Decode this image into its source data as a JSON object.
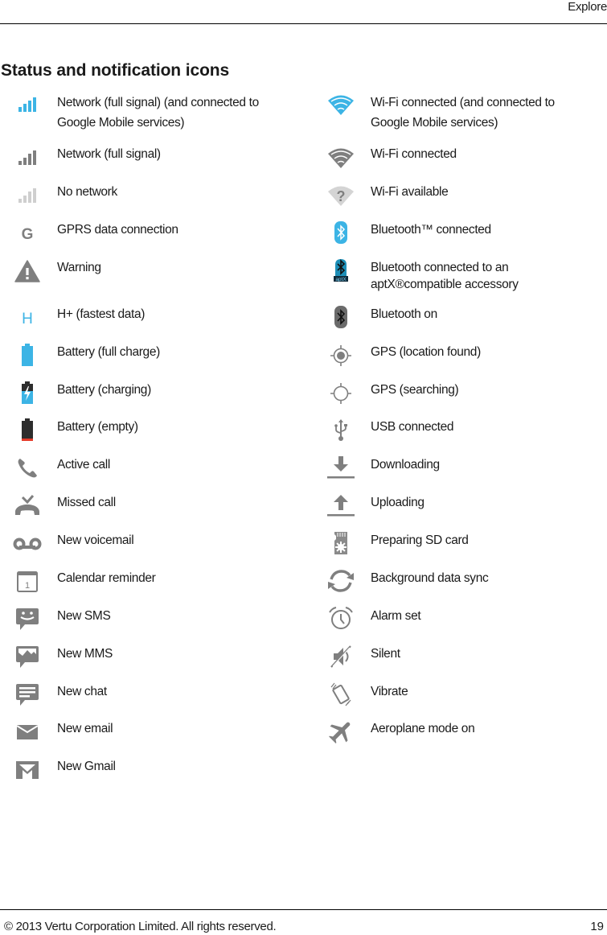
{
  "header": {
    "section": "Explore"
  },
  "title": "Status and notification icons",
  "colors": {
    "accent_blue": "#3cb4e5",
    "icon_grey": "#7f7f7f",
    "icon_light_grey": "#cfcfcf",
    "dark": "#2d2d2d",
    "battery_red": "#e53b2a"
  },
  "left_items": [
    {
      "icon": "signal-full-blue-icon",
      "label": "Network (full signal) (and connected to",
      "label2": "Google Mobile services)"
    },
    {
      "icon": "signal-full-icon",
      "label": "Network (full signal)"
    },
    {
      "icon": "no-network-icon",
      "label": "No network"
    },
    {
      "icon": "gprs-icon",
      "label": "GPRS data connection"
    },
    {
      "icon": "warning-icon",
      "label": "Warning"
    },
    {
      "icon": "h-plus-icon",
      "label": "H+ (fastest data)"
    },
    {
      "icon": "battery-full-icon",
      "label": "Battery (full charge)"
    },
    {
      "icon": "battery-charging-icon",
      "label": "Battery (charging)"
    },
    {
      "icon": "battery-empty-icon",
      "label": "Battery (empty)"
    },
    {
      "icon": "phone-icon",
      "label": "Active call"
    },
    {
      "icon": "missed-call-icon",
      "label": "Missed call"
    },
    {
      "icon": "voicemail-icon",
      "label": "New voicemail"
    },
    {
      "icon": "calendar-icon",
      "label": "Calendar reminder",
      "glyph": "1"
    },
    {
      "icon": "sms-icon",
      "label": "New SMS"
    },
    {
      "icon": "mms-icon",
      "label": "New MMS"
    },
    {
      "icon": "chat-icon",
      "label": "New chat"
    },
    {
      "icon": "email-icon",
      "label": "New email"
    },
    {
      "icon": "gmail-icon",
      "label": "New Gmail"
    }
  ],
  "right_items": [
    {
      "icon": "wifi-blue-icon",
      "label": "Wi-Fi connected (and connected to",
      "label2": "Google Mobile services)"
    },
    {
      "icon": "wifi-icon",
      "label": "Wi-Fi connected"
    },
    {
      "icon": "wifi-available-icon",
      "label": "Wi-Fi available",
      "glyph": "?"
    },
    {
      "icon": "bluetooth-connected-icon",
      "label": "Bluetooth™ connected"
    },
    {
      "icon": "bluetooth-aptx-icon",
      "label": "Bluetooth connected to an",
      "label2": "aptX®compatible accessory",
      "glyph": "aptX"
    },
    {
      "icon": "bluetooth-on-icon",
      "label": "Bluetooth on"
    },
    {
      "icon": "gps-found-icon",
      "label": "GPS (location found)"
    },
    {
      "icon": "gps-searching-icon",
      "label": "GPS (searching)"
    },
    {
      "icon": "usb-icon",
      "label": "USB connected"
    },
    {
      "icon": "download-icon",
      "label": "Downloading"
    },
    {
      "icon": "upload-icon",
      "label": "Uploading"
    },
    {
      "icon": "sd-card-icon",
      "label": "Preparing SD card"
    },
    {
      "icon": "sync-icon",
      "label": "Background data sync"
    },
    {
      "icon": "alarm-icon",
      "label": "Alarm set"
    },
    {
      "icon": "silent-icon",
      "label": "Silent"
    },
    {
      "icon": "vibrate-icon",
      "label": "Vibrate"
    },
    {
      "icon": "airplane-icon",
      "label": "Aeroplane mode on"
    }
  ],
  "footer": {
    "copyright": "© 2013 Vertu Corporation Limited. All rights reserved.",
    "page_number": "19"
  }
}
